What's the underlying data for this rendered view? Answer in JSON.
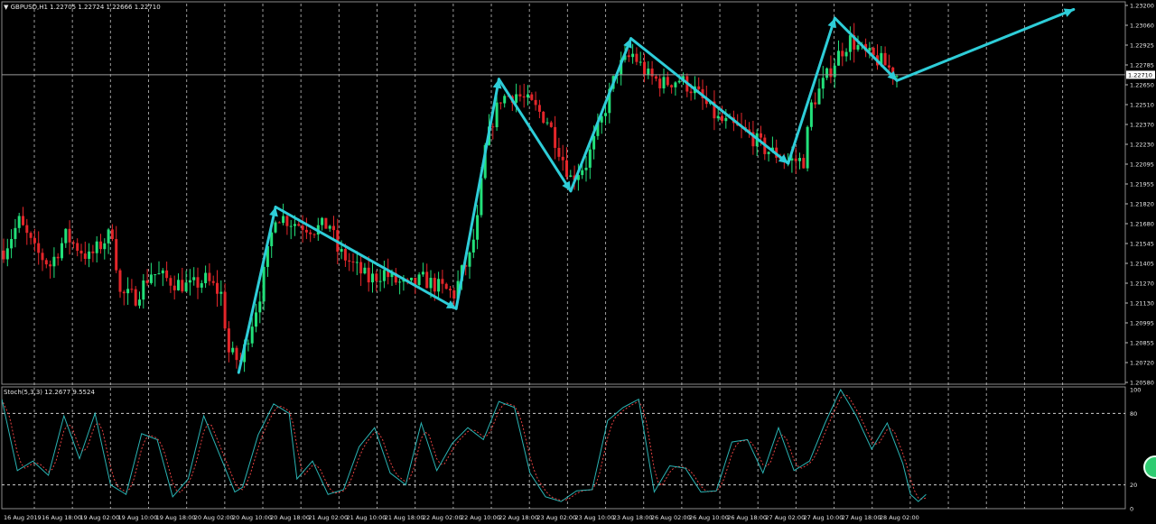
{
  "header": {
    "price_title": "▼ GBPUSD,H1  1.22705 1.22724 1.22666 1.22710",
    "osc_title": "Stoch(5,3,3) 12.2677 9.5524"
  },
  "colors": {
    "background": "#000000",
    "bull": "#22e07a",
    "bear": "#e3262a",
    "arrow": "#2ecdd8",
    "grid": "#d0d0d0",
    "stoch_main": "#2ab3b3",
    "stoch_signal": "#e34040",
    "current_price_label_bg": "#ffffff"
  },
  "chart_data": [
    {
      "type": "candlestick",
      "symbol": "GBPUSD",
      "timeframe": "H1",
      "ohlc_last": {
        "open": 1.22705,
        "high": 1.22724,
        "low": 1.22666,
        "close": 1.2271
      },
      "current_price": 1.2271,
      "current_price_label": "1.22710",
      "ylim": [
        1.2058,
        1.232
      ],
      "y_ticks": [
        "1.23200",
        "1.23060",
        "1.22925",
        "1.22785",
        "1.22650",
        "1.22510",
        "1.22370",
        "1.22230",
        "1.22095",
        "1.21955",
        "1.21820",
        "1.21680",
        "1.21545",
        "1.21405",
        "1.21270",
        "1.21130",
        "1.20995",
        "1.20855",
        "1.20720",
        "1.20580"
      ],
      "x_tick_labels": [
        "16 Aug 2019",
        "16 Aug 18:00",
        "19 Aug 02:00",
        "19 Aug 10:00",
        "19 Aug 18:00",
        "20 Aug 02:00",
        "20 Aug 10:00",
        "20 Aug 18:00",
        "21 Aug 02:00",
        "21 Aug 10:00",
        "21 Aug 18:00",
        "22 Aug 02:00",
        "22 Aug 10:00",
        "22 Aug 18:00",
        "23 Aug 02:00",
        "23 Aug 10:00",
        "23 Aug 18:00",
        "26 Aug 02:00",
        "26 Aug 10:00",
        "26 Aug 18:00",
        "27 Aug 02:00",
        "27 Aug 10:00",
        "27 Aug 18:00",
        "28 Aug 02:00"
      ],
      "zigzag_path": [
        {
          "x_index": 61.0,
          "price": 1.2066
        },
        {
          "x_index": 70.5,
          "price": 1.218
        },
        {
          "x_index": 117.0,
          "price": 1.211
        },
        {
          "x_index": 128.0,
          "price": 1.2268
        },
        {
          "x_index": 146.5,
          "price": 1.2191
        },
        {
          "x_index": 162.0,
          "price": 1.2296
        },
        {
          "x_index": 202.5,
          "price": 1.221
        },
        {
          "x_index": 214.5,
          "price": 1.231
        },
        {
          "x_index": 230.5,
          "price": 1.2267
        },
        {
          "x_index": 276.0,
          "price": 1.2316
        }
      ],
      "price_anchors": [
        [
          0,
          1.215
        ],
        [
          4,
          1.217
        ],
        [
          8,
          1.215
        ],
        [
          12,
          1.214
        ],
        [
          16,
          1.216
        ],
        [
          22,
          1.2145
        ],
        [
          28,
          1.2163
        ],
        [
          30,
          1.212
        ],
        [
          34,
          1.2118
        ],
        [
          38,
          1.2135
        ],
        [
          44,
          1.2128
        ],
        [
          48,
          1.2125
        ],
        [
          52,
          1.213
        ],
        [
          56,
          1.212
        ],
        [
          58,
          1.208
        ],
        [
          61,
          1.2073
        ],
        [
          66,
          1.212
        ],
        [
          70,
          1.2175
        ],
        [
          74,
          1.217
        ],
        [
          80,
          1.2165
        ],
        [
          84,
          1.2168
        ],
        [
          86,
          1.215
        ],
        [
          90,
          1.214
        ],
        [
          94,
          1.213
        ],
        [
          98,
          1.2135
        ],
        [
          100,
          1.213
        ],
        [
          104,
          1.2125
        ],
        [
          108,
          1.213
        ],
        [
          112,
          1.2125
        ],
        [
          116,
          1.212
        ],
        [
          118,
          1.2135
        ],
        [
          120,
          1.2145
        ],
        [
          122,
          1.217
        ],
        [
          124,
          1.222
        ],
        [
          126,
          1.224
        ],
        [
          128,
          1.2255
        ],
        [
          132,
          1.2258
        ],
        [
          136,
          1.225
        ],
        [
          140,
          1.224
        ],
        [
          143,
          1.222
        ],
        [
          146,
          1.22
        ],
        [
          150,
          1.221
        ],
        [
          154,
          1.224
        ],
        [
          158,
          1.2275
        ],
        [
          160,
          1.228
        ],
        [
          162,
          1.2285
        ],
        [
          166,
          1.227
        ],
        [
          170,
          1.2265
        ],
        [
          174,
          1.2268
        ],
        [
          178,
          1.226
        ],
        [
          181,
          1.225
        ],
        [
          184,
          1.224
        ],
        [
          188,
          1.2235
        ],
        [
          192,
          1.223
        ],
        [
          196,
          1.222
        ],
        [
          200,
          1.2215
        ],
        [
          202,
          1.2212
        ],
        [
          206,
          1.2212
        ],
        [
          208,
          1.225
        ],
        [
          212,
          1.227
        ],
        [
          215,
          1.2285
        ],
        [
          218,
          1.2295
        ],
        [
          222,
          1.2285
        ],
        [
          226,
          1.228
        ],
        [
          230,
          1.2271
        ]
      ]
    },
    {
      "type": "line",
      "indicator": "Stochastic Oscillator",
      "params": "(5,3,3)",
      "main_value": 12.2677,
      "signal_value": 9.5524,
      "ylim": [
        0,
        100
      ],
      "y_ticks": [
        "100",
        "80",
        "20",
        "0"
      ],
      "levels": [
        80,
        20
      ],
      "main_anchors": [
        [
          0,
          92
        ],
        [
          4,
          32
        ],
        [
          8,
          40
        ],
        [
          12,
          28
        ],
        [
          16,
          78
        ],
        [
          20,
          42
        ],
        [
          24,
          80
        ],
        [
          28,
          20
        ],
        [
          32,
          12
        ],
        [
          36,
          63
        ],
        [
          40,
          58
        ],
        [
          44,
          10
        ],
        [
          48,
          25
        ],
        [
          52,
          78
        ],
        [
          56,
          46
        ],
        [
          60,
          14
        ],
        [
          62,
          18
        ],
        [
          66,
          62
        ],
        [
          70,
          88
        ],
        [
          74,
          80
        ],
        [
          76,
          25
        ],
        [
          80,
          40
        ],
        [
          84,
          12
        ],
        [
          88,
          16
        ],
        [
          92,
          52
        ],
        [
          96,
          68
        ],
        [
          100,
          30
        ],
        [
          104,
          20
        ],
        [
          108,
          72
        ],
        [
          112,
          32
        ],
        [
          116,
          55
        ],
        [
          120,
          68
        ],
        [
          124,
          58
        ],
        [
          128,
          90
        ],
        [
          132,
          85
        ],
        [
          136,
          30
        ],
        [
          140,
          10
        ],
        [
          144,
          6
        ],
        [
          148,
          15
        ],
        [
          152,
          16
        ],
        [
          156,
          74
        ],
        [
          160,
          85
        ],
        [
          164,
          92
        ],
        [
          168,
          14
        ],
        [
          172,
          36
        ],
        [
          176,
          34
        ],
        [
          180,
          14
        ],
        [
          184,
          15
        ],
        [
          188,
          56
        ],
        [
          192,
          58
        ],
        [
          196,
          30
        ],
        [
          200,
          68
        ],
        [
          204,
          32
        ],
        [
          208,
          40
        ],
        [
          212,
          72
        ],
        [
          216,
          100
        ],
        [
          220,
          78
        ],
        [
          224,
          50
        ],
        [
          228,
          72
        ],
        [
          232,
          38
        ],
        [
          234,
          12
        ],
        [
          236,
          6
        ],
        [
          238,
          12
        ]
      ]
    }
  ]
}
